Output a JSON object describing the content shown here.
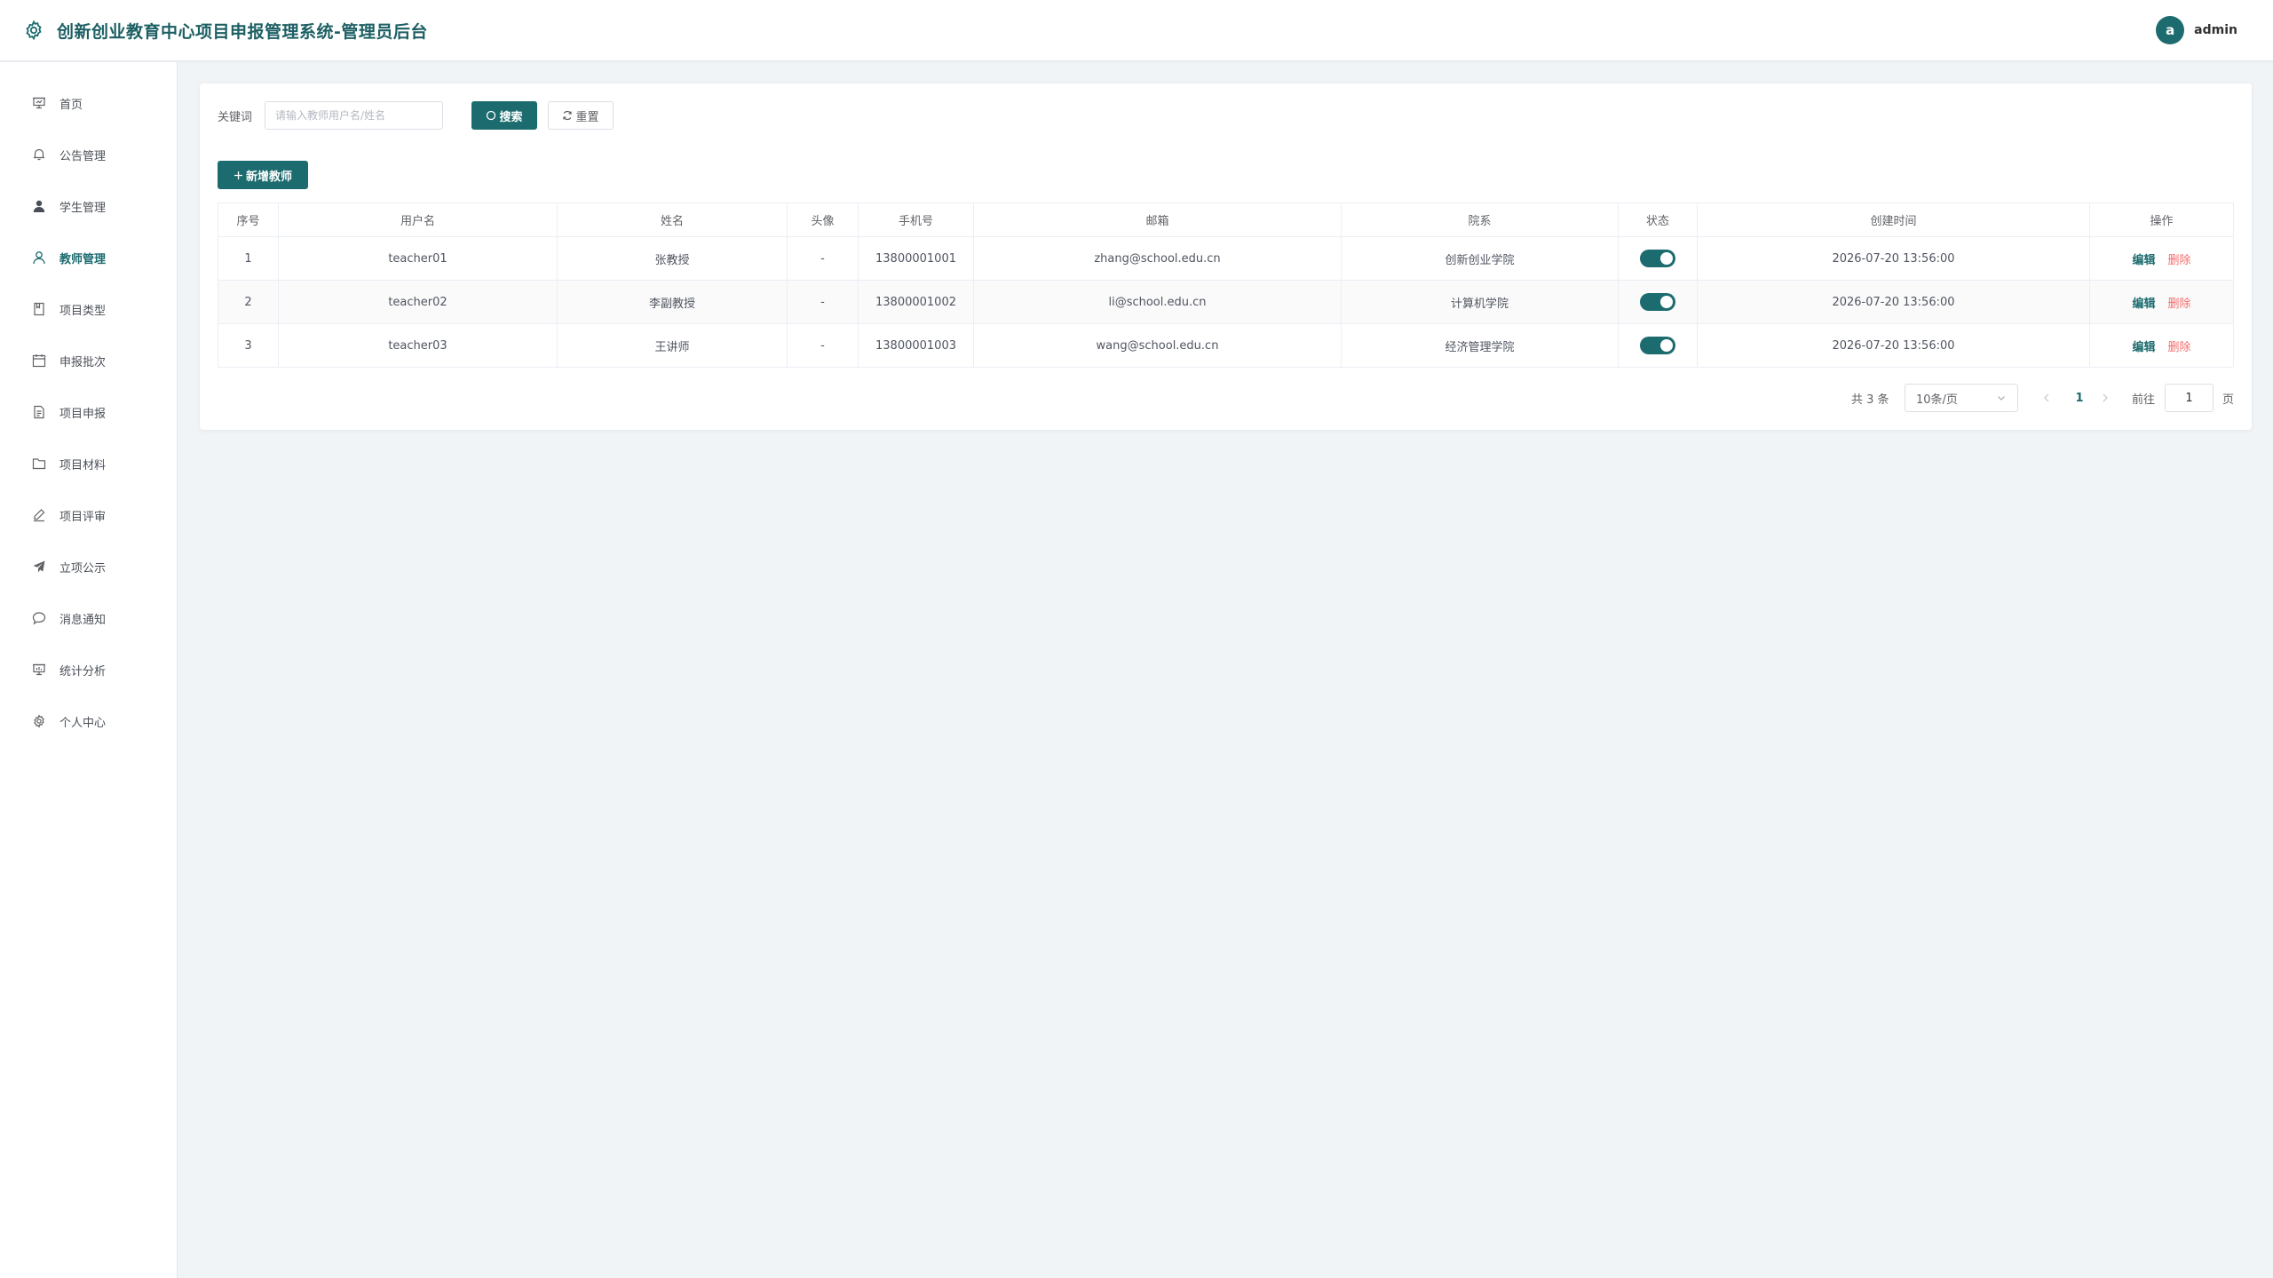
{
  "app": {
    "title": "创新创业教育中心项目申报管理系统-管理员后台",
    "user": {
      "avatar_letter": "a",
      "name": "admin"
    },
    "accent_color": "#1c6b6f",
    "danger_color": "#f56c6c"
  },
  "sidebar": {
    "items": [
      {
        "label": "首页",
        "icon": "home-icon"
      },
      {
        "label": "公告管理",
        "icon": "bell-icon"
      },
      {
        "label": "学生管理",
        "icon": "user-filled-icon"
      },
      {
        "label": "教师管理",
        "icon": "user-icon",
        "active": true
      },
      {
        "label": "项目类型",
        "icon": "notebook-icon"
      },
      {
        "label": "申报批次",
        "icon": "calendar-icon"
      },
      {
        "label": "项目申报",
        "icon": "document-icon"
      },
      {
        "label": "项目材料",
        "icon": "folder-icon"
      },
      {
        "label": "项目评审",
        "icon": "edit-pen-icon"
      },
      {
        "label": "立项公示",
        "icon": "send-icon"
      },
      {
        "label": "消息通知",
        "icon": "chat-icon"
      },
      {
        "label": "统计分析",
        "icon": "data-board-icon"
      },
      {
        "label": "个人中心",
        "icon": "setting-icon"
      }
    ]
  },
  "search": {
    "label": "关键词",
    "placeholder": "请输入教师用户名/姓名",
    "value": "",
    "search_button": "搜索",
    "reset_button": "重置"
  },
  "toolbar": {
    "add_button": "新增教师"
  },
  "table": {
    "columns": [
      "序号",
      "用户名",
      "姓名",
      "头像",
      "手机号",
      "邮箱",
      "院系",
      "状态",
      "创建时间",
      "操作"
    ],
    "rows": [
      {
        "index": "1",
        "username": "teacher01",
        "name": "张教授",
        "avatar": "-",
        "phone": "13800001001",
        "email": "zhang@school.edu.cn",
        "department": "创新创业学院",
        "status": true,
        "created": "2026-07-20 13:56:00"
      },
      {
        "index": "2",
        "username": "teacher02",
        "name": "李副教授",
        "avatar": "-",
        "phone": "13800001002",
        "email": "li@school.edu.cn",
        "department": "计算机学院",
        "status": true,
        "created": "2026-07-20 13:56:00"
      },
      {
        "index": "3",
        "username": "teacher03",
        "name": "王讲师",
        "avatar": "-",
        "phone": "13800001003",
        "email": "wang@school.edu.cn",
        "department": "经济管理学院",
        "status": true,
        "created": "2026-07-20 13:56:00"
      }
    ],
    "actions": {
      "edit": "编辑",
      "delete": "删除"
    }
  },
  "pagination": {
    "total_text": "共 3 条",
    "page_size": "10条/页",
    "current_page": "1",
    "goto_label": "前往",
    "goto_value": "1",
    "goto_unit": "页"
  }
}
